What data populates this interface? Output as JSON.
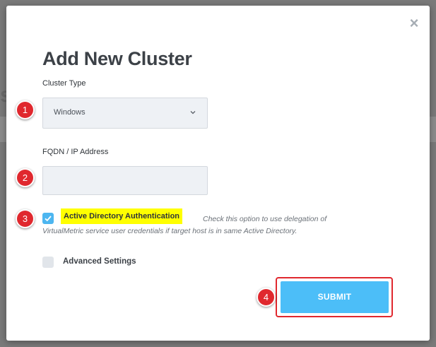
{
  "background": {
    "partial_text": "s"
  },
  "dialog": {
    "title": "Add New Cluster",
    "close_icon": "close-icon",
    "cluster_type": {
      "label": "Cluster Type",
      "selected": "Windows"
    },
    "fqdn": {
      "label": "FQDN / IP Address",
      "value": ""
    },
    "active_directory": {
      "checked": true,
      "label": "Active Directory Authentication",
      "description_line1": "Check this option to use delegation of",
      "description_line2": "VirtualMetric service user credentials if target host is in same Active Directory."
    },
    "advanced_settings": {
      "checked": false,
      "label": "Advanced Settings"
    },
    "submit_label": "SUBMIT"
  },
  "annotations": {
    "steps": [
      "1",
      "2",
      "3",
      "4"
    ]
  },
  "colors": {
    "accent": "#4cbef8",
    "checkbox_checked": "#4db6f0",
    "highlight": "#ffff00",
    "annotation_red": "#e0282e"
  }
}
